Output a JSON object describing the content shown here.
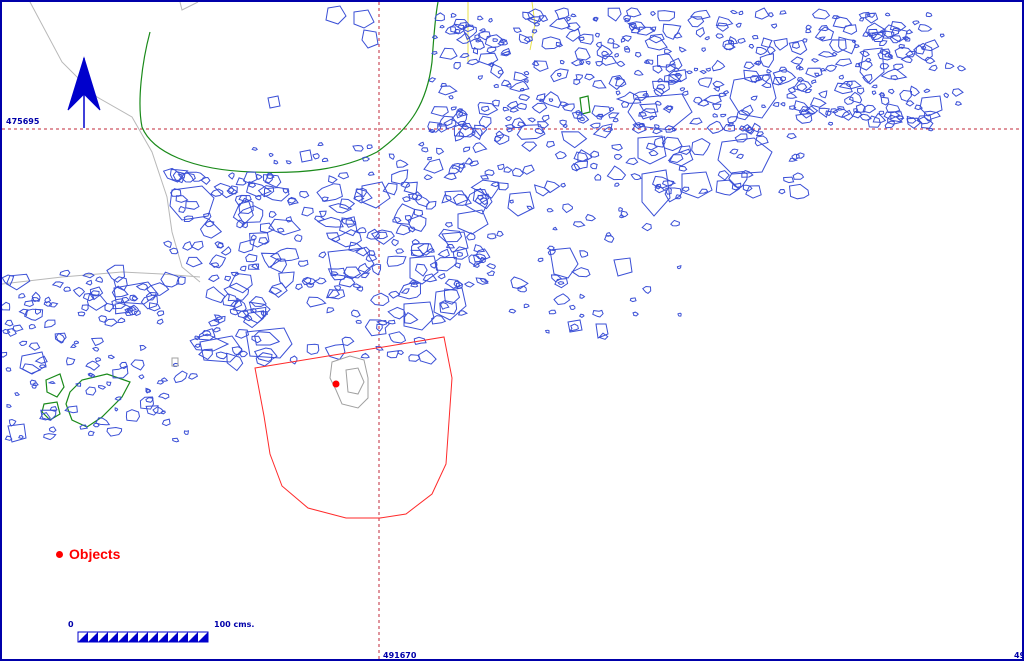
{
  "map": {
    "grid_labels": {
      "northing": "475695",
      "easting_1": "491670",
      "easting_2": "49"
    },
    "legend": {
      "objects_label": "Objects"
    },
    "scale": {
      "min_label": "0",
      "max_label": "100 cms."
    }
  },
  "colors": {
    "stones": "#3a4fd6",
    "grid": "#c0283a",
    "excavation_area": "#ff2a2a",
    "objects": "#ff0000",
    "vegetation": "#1a8a1a",
    "boundary_yellow": "#e8e04a",
    "trail": "#b8b8b8",
    "north_arrow": "#0000cc",
    "frame": "#0000aa"
  },
  "icons": {
    "north_arrow": "north-arrow-icon",
    "object_marker": "red-dot-marker-icon"
  }
}
